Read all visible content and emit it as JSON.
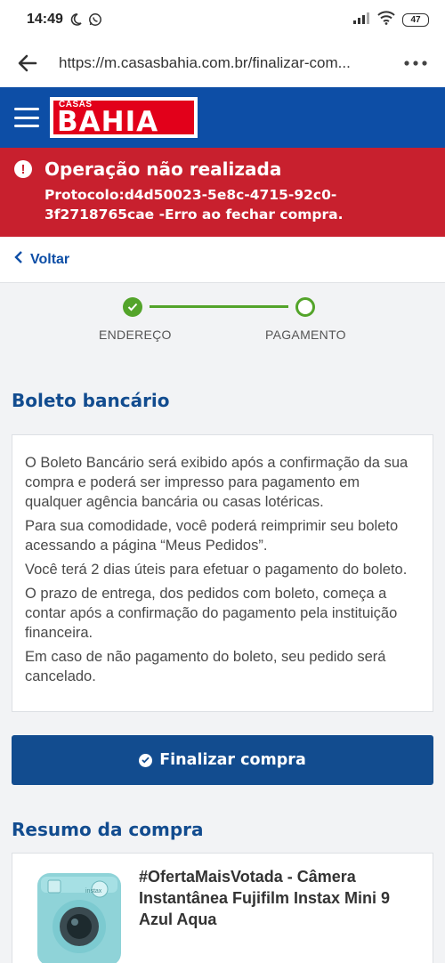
{
  "status_bar": {
    "time": "14:49",
    "battery": "47"
  },
  "browser": {
    "url": "https://m.casasbahia.com.br/finalizar-com..."
  },
  "header": {
    "logo_small": "CASAS",
    "logo_large": "BAHIA",
    "brand_color": "#0d4ea6",
    "logo_color": "#e2001a"
  },
  "error": {
    "title": "Operação não realizada",
    "message": "Protocolo:d4d50023-5e8c-4715-92c0-3f2718765cae -Erro ao fechar compra.",
    "color": "#c8202e"
  },
  "nav": {
    "back_label": "Voltar"
  },
  "stepper": {
    "steps": [
      {
        "label": "ENDEREÇO",
        "state": "done"
      },
      {
        "label": "PAGAMENTO",
        "state": "current"
      }
    ],
    "color": "#53a42a"
  },
  "boleto": {
    "title": "Boleto bancário",
    "paragraphs": [
      "O Boleto Bancário será exibido após a confirmação da sua compra e poderá ser impresso para pagamento em qualquer agência bancária ou casas lotéricas.",
      "Para sua comodidade, você poderá reimprimir seu boleto acessando a página “Meus Pedidos”.",
      "Você terá 2 dias úteis para efetuar o pagamento do boleto.",
      "O prazo de entrega, dos pedidos com boleto, começa a contar após a confirmação do pagamento pela instituição financeira.",
      "Em caso de não pagamento do boleto, seu pedido será cancelado."
    ]
  },
  "actions": {
    "finalizar_label": "Finalizar compra"
  },
  "summary": {
    "title": "Resumo da compra",
    "product_title": "#OfertaMaisVotada - Câmera Instantânea Fujifilm Instax Mini 9 Azul Aqua",
    "product_image": "camera-instax-aqua"
  }
}
